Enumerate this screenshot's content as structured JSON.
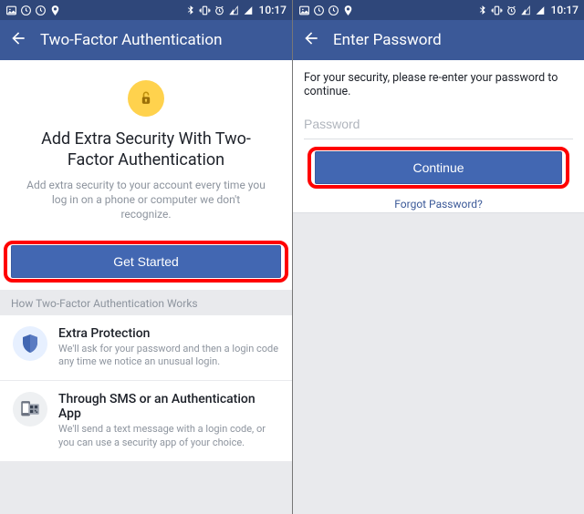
{
  "status": {
    "time": "10:17",
    "left_icons": [
      "image-icon",
      "clock-icon",
      "clock-icon",
      "location-icon"
    ],
    "right_icons": [
      "bluetooth-icon",
      "vibrate-icon",
      "alarm-icon",
      "signal-icon",
      "signal-icon"
    ]
  },
  "screen1": {
    "header_title": "Two-Factor Authentication",
    "hero_title": "Add Extra Security With Two-Factor Authentication",
    "hero_desc": "Add extra security to your account every time you log in on a phone or computer we don't recognize.",
    "cta_label": "Get Started",
    "section_label": "How Two-Factor Authentication Works",
    "items": [
      {
        "title": "Extra Protection",
        "desc": "We'll ask for your password and then a login code any time we notice an unusual login."
      },
      {
        "title": "Through SMS or an Authentication App",
        "desc": "We'll send a text message with a login code, or you can use a security app of your choice."
      }
    ]
  },
  "screen2": {
    "header_title": "Enter Password",
    "prompt": "For your security, please re-enter your password to continue.",
    "password_placeholder": "Password",
    "password_value": "",
    "cta_label": "Continue",
    "forgot_label": "Forgot Password?"
  },
  "colors": {
    "fb_blue": "#3b5998",
    "btn_blue": "#4267b2",
    "highlight_red": "#ff0000"
  }
}
